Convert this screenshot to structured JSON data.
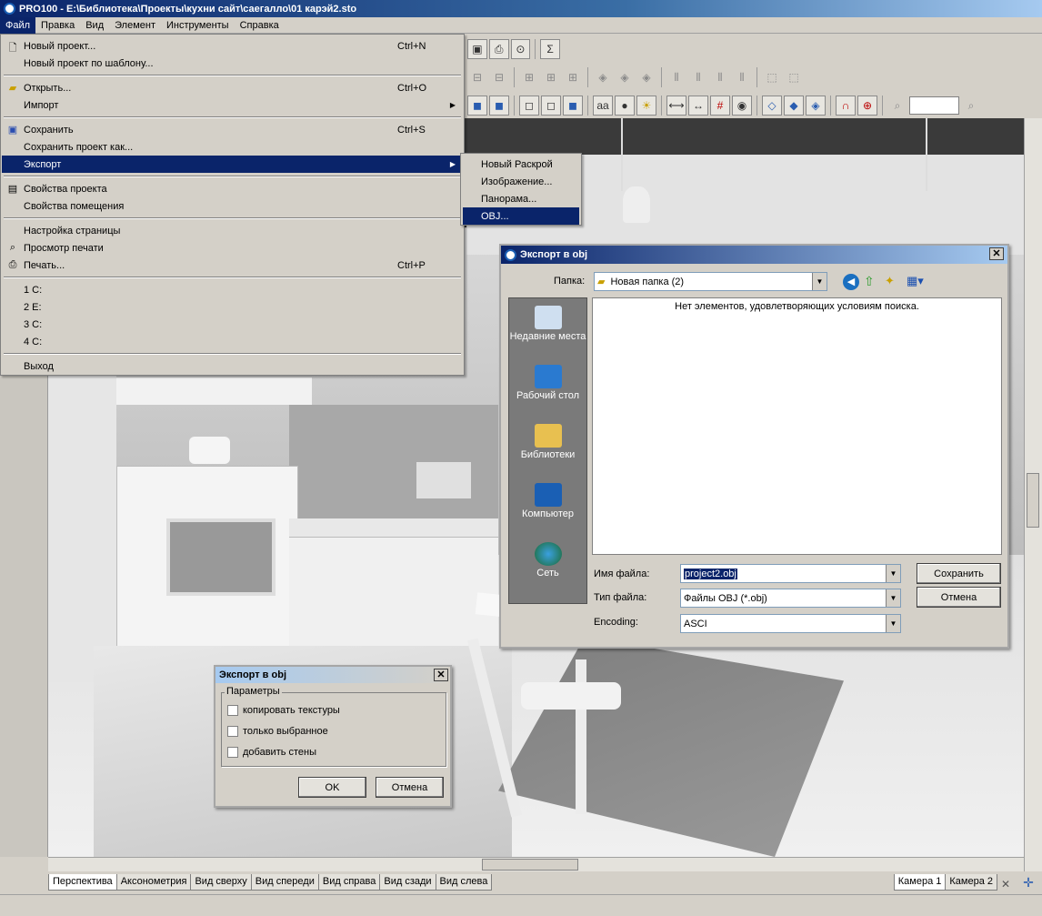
{
  "app": {
    "title": "PRO100 - E:\\Библиотека\\Проекты\\кухни сайт\\саегалло\\01 карэй2.sto"
  },
  "menubar": [
    "Файл",
    "Правка",
    "Вид",
    "Элемент",
    "Инструменты",
    "Справка"
  ],
  "file_menu": {
    "new_project": "Новый проект...",
    "new_project_sc": "Ctrl+N",
    "new_from_template": "Новый проект по шаблону...",
    "open": "Открыть...",
    "open_sc": "Ctrl+O",
    "import": "Импорт",
    "save": "Сохранить",
    "save_sc": "Ctrl+S",
    "save_as": "Сохранить проект как...",
    "export": "Экспорт",
    "project_props": "Свойства проекта",
    "room_props": "Свойства помещения",
    "page_setup": "Настройка страницы",
    "print_preview": "Просмотр печати",
    "print": "Печать...",
    "print_sc": "Ctrl+P",
    "recent": [
      "1 C:",
      "2 E:",
      "3 C:",
      "4 C:"
    ],
    "exit": "Выход"
  },
  "export_submenu": [
    "Новый Раскрой",
    "Изображение...",
    "Панорама...",
    "OBJ..."
  ],
  "save_dialog": {
    "title": "Экспорт в obj",
    "folder_label": "Папка:",
    "folder_value": "Новая папка (2)",
    "empty_message": "Нет элементов, удовлетворяющих условиям поиска.",
    "places": [
      "Недавние места",
      "Рабочий стол",
      "Библиотеки",
      "Компьютер",
      "Сеть"
    ],
    "filename_label": "Имя файла:",
    "filename_value": "project2.obj",
    "filetype_label": "Тип файла:",
    "filetype_value": "Файлы OBJ (*.obj)",
    "encoding_label": "Encoding:",
    "encoding_value": "ASCI",
    "save_button": "Сохранить",
    "cancel_button": "Отмена"
  },
  "params_dialog": {
    "title": "Экспорт в obj",
    "group_label": "Параметры",
    "options": [
      "копировать текстуры",
      "только выбранное",
      "добавить стены"
    ],
    "ok_button": "OK",
    "cancel_button": "Отмена"
  },
  "view_tabs": [
    "Перспектива",
    "Аксонометрия",
    "Вид сверху",
    "Вид спереди",
    "Вид справа",
    "Вид сзади",
    "Вид слева"
  ],
  "camera_tabs": [
    "Камера 1",
    "Камера 2"
  ],
  "toolbar": {
    "sigma": "Σ",
    "text_glyph": "aa"
  }
}
